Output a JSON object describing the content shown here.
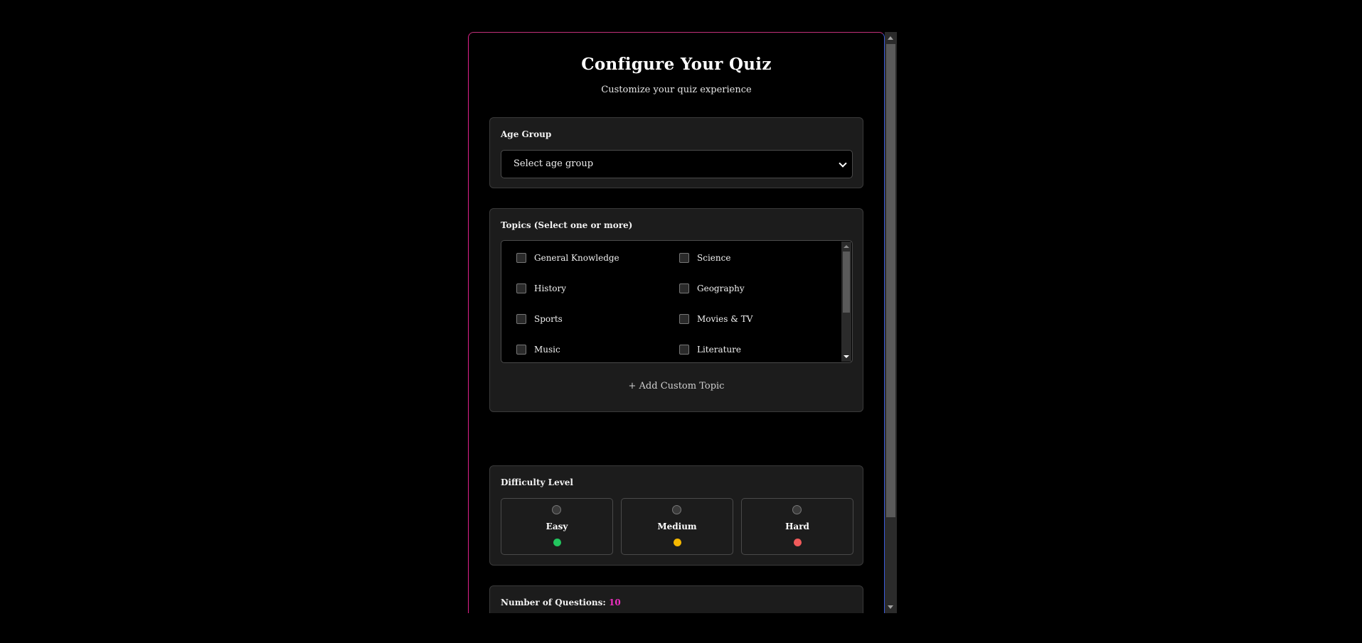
{
  "quiz": {
    "title": "Configure Your Quiz",
    "subtitle": "Customize your quiz experience"
  },
  "age_group": {
    "label": "Age Group",
    "selected": "Select age group"
  },
  "topics": {
    "label": "Topics (Select one or more)",
    "items": [
      "General Knowledge",
      "Science",
      "History",
      "Geography",
      "Sports",
      "Movies & TV",
      "Music",
      "Literature"
    ],
    "add_label": "+ Add Custom Topic"
  },
  "difficulty": {
    "label": "Difficulty Level",
    "options": [
      {
        "label": "Easy",
        "color": "#22c55e"
      },
      {
        "label": "Medium",
        "color": "#f5b800"
      },
      {
        "label": "Hard",
        "color": "#f05a5a"
      }
    ]
  },
  "questions": {
    "label": "Number of Questions:",
    "count": "10",
    "slider_fraction": 0.5
  },
  "colors": {
    "accent": "#f02fc2",
    "thumb": "#3b82f6"
  }
}
